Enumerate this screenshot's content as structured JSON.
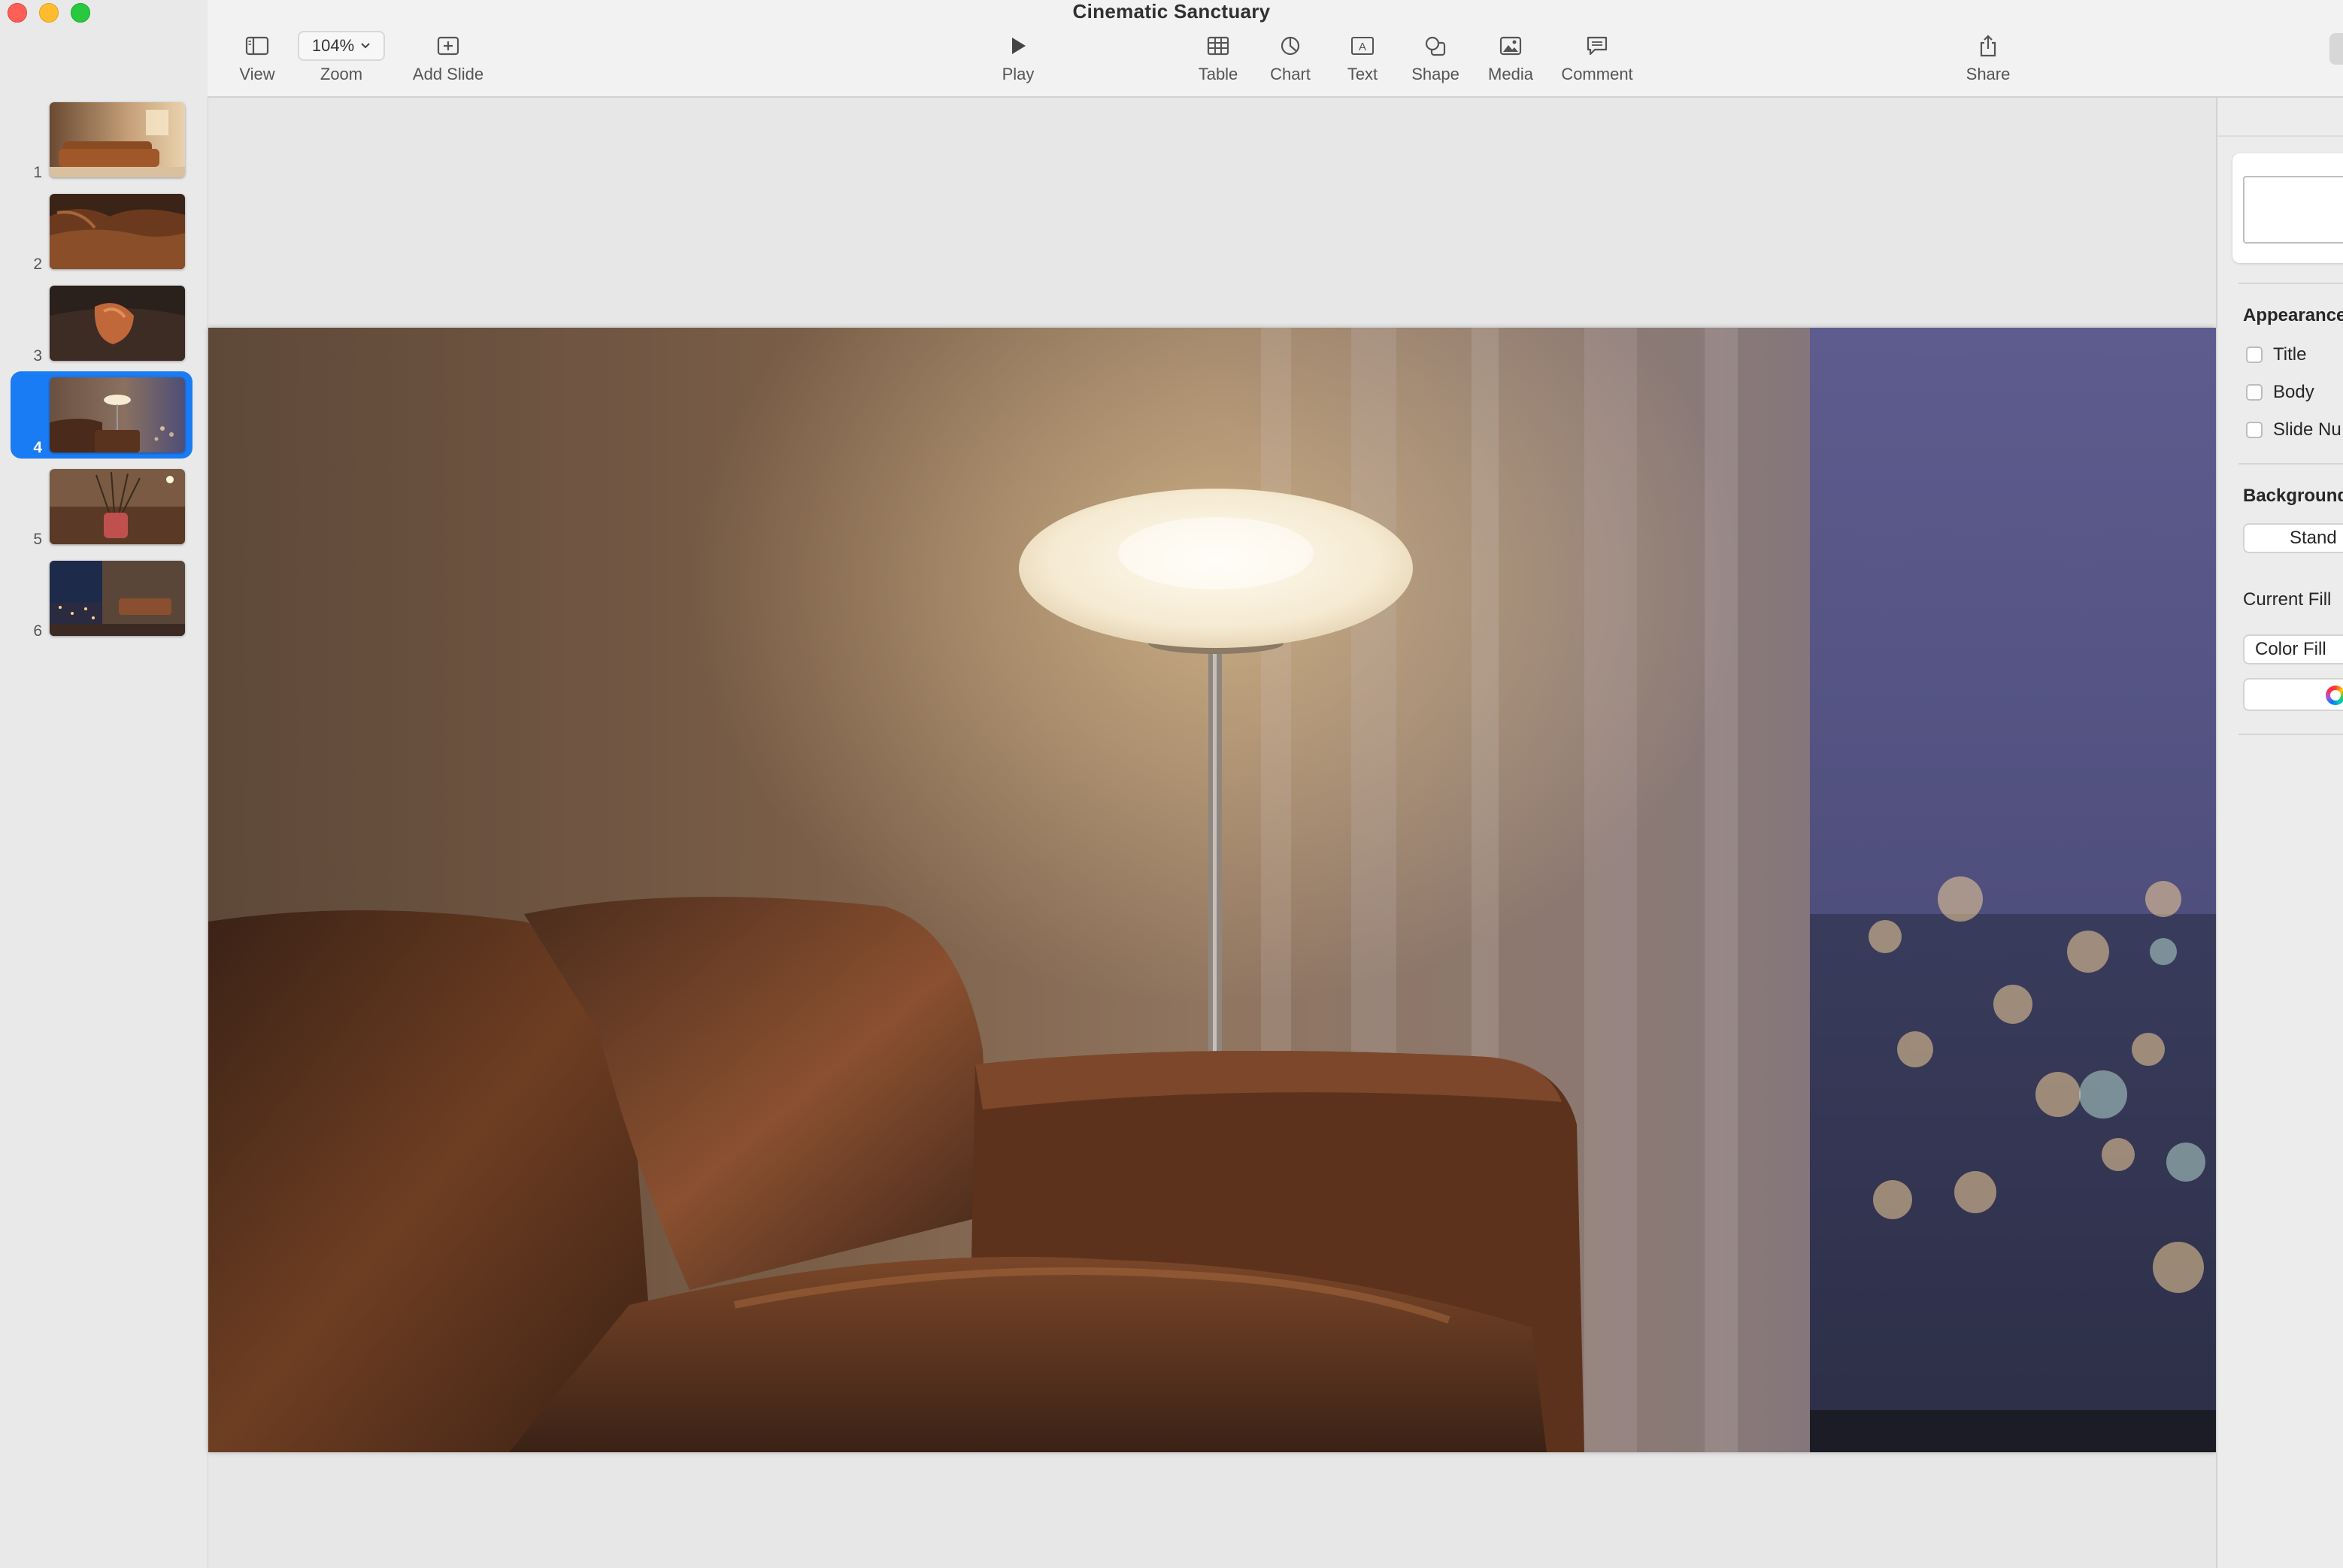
{
  "window": {
    "title": "Cinematic Sanctuary"
  },
  "toolbar": {
    "view_label": "View",
    "zoom_value": "104%",
    "zoom_label": "Zoom",
    "add_slide_label": "Add Slide",
    "play_label": "Play",
    "table_label": "Table",
    "chart_label": "Chart",
    "text_label": "Text",
    "shape_label": "Shape",
    "media_label": "Media",
    "comment_label": "Comment",
    "share_label": "Share"
  },
  "slides": [
    {
      "number": "1",
      "selected": false
    },
    {
      "number": "2",
      "selected": false
    },
    {
      "number": "3",
      "selected": false
    },
    {
      "number": "4",
      "selected": true
    },
    {
      "number": "5",
      "selected": false
    },
    {
      "number": "6",
      "selected": false
    }
  ],
  "inspector": {
    "appearance_heading": "Appearance",
    "checkbox_title": "Title",
    "checkbox_body": "Body",
    "checkbox_slide_number": "Slide Nu",
    "background_heading": "Background",
    "background_style": "Stand",
    "current_fill_heading": "Current Fill",
    "fill_type": "Color Fill"
  },
  "colors": {
    "accent": "#1a7cf5",
    "close": "#fe5f57",
    "minimize": "#febc2e",
    "maximize": "#28c840"
  }
}
